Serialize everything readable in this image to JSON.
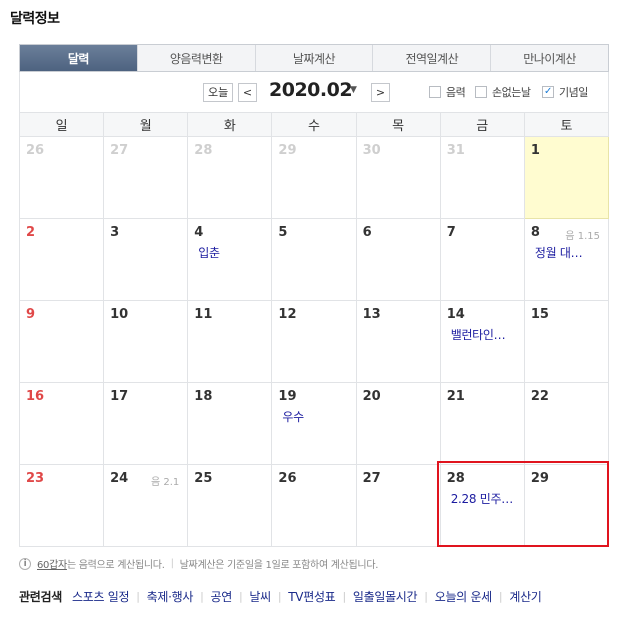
{
  "title": "달력정보",
  "tabs": [
    "달력",
    "양음력변환",
    "날짜계산",
    "전역일계산",
    "만나이계산"
  ],
  "controls": {
    "today_label": "오늘",
    "prev_label": "<",
    "next_label": ">",
    "month": "2020.02",
    "caret": "▼",
    "checkboxes": [
      {
        "label": "음력",
        "checked": false,
        "mark": ""
      },
      {
        "label": "손없는날",
        "checked": false,
        "mark": ""
      },
      {
        "label": "기념일",
        "checked": true,
        "mark": "✓"
      }
    ]
  },
  "weekdays": [
    "일",
    "월",
    "화",
    "수",
    "목",
    "금",
    "토"
  ],
  "weeks": [
    [
      {
        "d": "26",
        "o": true
      },
      {
        "d": "27",
        "o": true
      },
      {
        "d": "28",
        "o": true
      },
      {
        "d": "29",
        "o": true
      },
      {
        "d": "30",
        "o": true
      },
      {
        "d": "31",
        "o": true
      },
      {
        "d": "1",
        "today": true
      }
    ],
    [
      {
        "d": "2"
      },
      {
        "d": "3"
      },
      {
        "d": "4",
        "ev": "입춘"
      },
      {
        "d": "5"
      },
      {
        "d": "6"
      },
      {
        "d": "7"
      },
      {
        "d": "8",
        "ev": "정월 대…",
        "lunar": "음 1.15"
      }
    ],
    [
      {
        "d": "9"
      },
      {
        "d": "10"
      },
      {
        "d": "11"
      },
      {
        "d": "12"
      },
      {
        "d": "13"
      },
      {
        "d": "14",
        "ev": "밸런타인…"
      },
      {
        "d": "15"
      }
    ],
    [
      {
        "d": "16"
      },
      {
        "d": "17"
      },
      {
        "d": "18"
      },
      {
        "d": "19",
        "ev": "우수"
      },
      {
        "d": "20"
      },
      {
        "d": "21"
      },
      {
        "d": "22"
      }
    ],
    [
      {
        "d": "23"
      },
      {
        "d": "24",
        "lunar": "음 2.1"
      },
      {
        "d": "25"
      },
      {
        "d": "26"
      },
      {
        "d": "27"
      },
      {
        "d": "28",
        "ev": "2.28 민주…"
      },
      {
        "d": "29"
      }
    ]
  ],
  "note": {
    "icon": "i",
    "link": "60갑자",
    "text1": "는 음력으로 계산됩니다.",
    "text2": "날짜계산은 기준일을 1일로 포함하여 계산됩니다."
  },
  "related": {
    "label": "관련검색",
    "links": [
      "스포츠 일정",
      "축제·행사",
      "공연",
      "날씨",
      "TV편성표",
      "일출일몰시간",
      "오늘의 운세",
      "계산기"
    ]
  }
}
